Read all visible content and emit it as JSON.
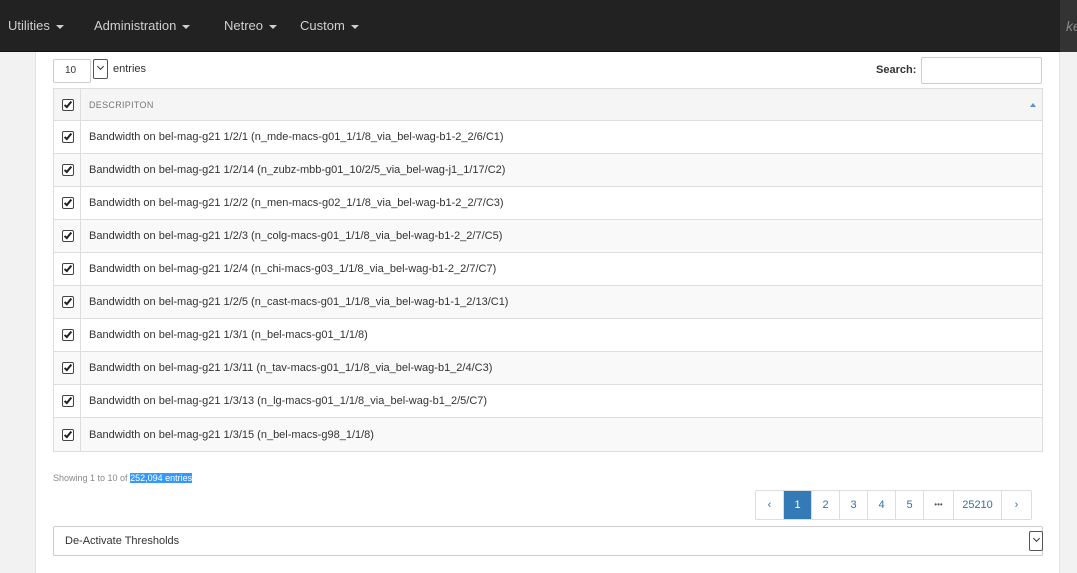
{
  "nav": {
    "items": [
      "Utilities",
      "Administration",
      "Netreo",
      "Custom"
    ],
    "right_text": "ke"
  },
  "table_controls": {
    "length_value": "10",
    "length_suffix": "entries",
    "search_label": "Search:",
    "search_value": ""
  },
  "table": {
    "header": "DESCRIPITON",
    "rows": [
      "Bandwidth on bel-mag-g21 1/2/1 (n_mde-macs-g01_1/1/8_via_bel-wag-b1-2_2/6/C1)",
      "Bandwidth on bel-mag-g21 1/2/14 (n_zubz-mbb-g01_10/2/5_via_bel-wag-j1_1/17/C2)",
      "Bandwidth on bel-mag-g21 1/2/2 (n_men-macs-g02_1/1/8_via_bel-wag-b1-2_2/7/C3)",
      "Bandwidth on bel-mag-g21 1/2/3 (n_colg-macs-g01_1/1/8_via_bel-wag-b1-2_2/7/C5)",
      "Bandwidth on bel-mag-g21 1/2/4 (n_chi-macs-g03_1/1/8_via_bel-wag-b1-2_2/7/C7)",
      "Bandwidth on bel-mag-g21 1/2/5 (n_cast-macs-g01_1/1/8_via_bel-wag-b1-1_2/13/C1)",
      "Bandwidth on bel-mag-g21 1/3/1 (n_bel-macs-g01_1/1/8)",
      "Bandwidth on bel-mag-g21 1/3/11 (n_tav-macs-g01_1/1/8_via_bel-wag-b1_2/4/C3)",
      "Bandwidth on bel-mag-g21 1/3/13 (n_lg-macs-g01_1/1/8_via_bel-wag-b1_2/5/C7)",
      "Bandwidth on bel-mag-g21 1/3/15 (n_bel-macs-g98_1/1/8)"
    ]
  },
  "info": {
    "prefix": "Showing 1 to 10 of ",
    "highlight": "252,094 entries"
  },
  "pagination": {
    "prev": "‹",
    "pages": [
      "1",
      "2",
      "3",
      "4",
      "5"
    ],
    "ellipsis": "•••",
    "last": "25210",
    "next": "›"
  },
  "action": {
    "selected": "De-Activate Thresholds"
  },
  "colors": {
    "navbar": "#222222",
    "accent": "#337ab7",
    "selection": "#3399ff"
  }
}
